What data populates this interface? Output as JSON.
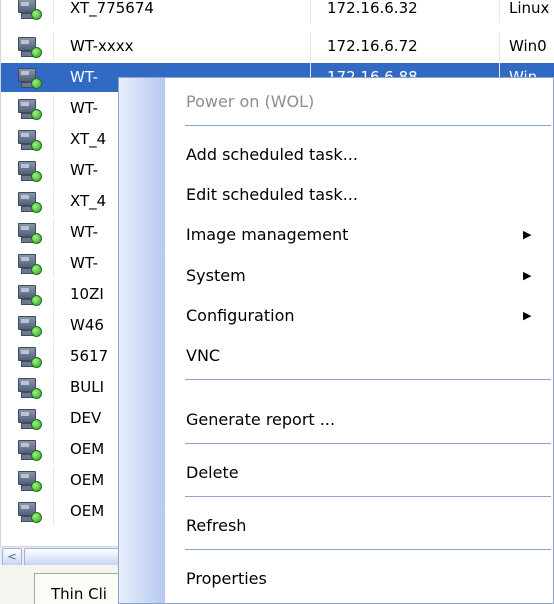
{
  "device_list": {
    "rows": [
      {
        "name": "XT_775674",
        "ip": "172.16.6.32",
        "os": "Linux",
        "selected": false
      },
      {
        "name": "WT-xxxx",
        "ip": "172.16.6.72",
        "os": "Win0",
        "selected": false
      },
      {
        "name": "WT-",
        "ip": "172.16.6.88",
        "os": "Win",
        "selected": true
      },
      {
        "name": "WT-",
        "ip": "",
        "os": "",
        "selected": false
      },
      {
        "name": "XT_4",
        "ip": "",
        "os": "",
        "selected": false
      },
      {
        "name": "WT-",
        "ip": "",
        "os": "",
        "selected": false
      },
      {
        "name": "XT_4",
        "ip": "",
        "os": "",
        "selected": false
      },
      {
        "name": "WT-",
        "ip": "",
        "os": "",
        "selected": false
      },
      {
        "name": "WT-",
        "ip": "",
        "os": "",
        "selected": false
      },
      {
        "name": "10ZI",
        "ip": "",
        "os": "",
        "selected": false
      },
      {
        "name": "W46",
        "ip": "",
        "os": "",
        "selected": false
      },
      {
        "name": "5617",
        "ip": "",
        "os": "",
        "selected": false
      },
      {
        "name": "BULI",
        "ip": "",
        "os": "",
        "selected": false
      },
      {
        "name": "DEV",
        "ip": "",
        "os": "",
        "selected": false
      },
      {
        "name": "OEM",
        "ip": "",
        "os": "",
        "selected": false
      },
      {
        "name": "OEM",
        "ip": "",
        "os": "",
        "selected": false
      },
      {
        "name": "OEM",
        "ip": "",
        "os": "",
        "selected": false
      }
    ]
  },
  "scrollbar": {
    "left_arrow": "<"
  },
  "bottom_tab": {
    "label": "Thin Cli"
  },
  "context_menu": {
    "items": [
      {
        "label": "Power on (WOL)",
        "enabled": false,
        "submenu": false
      },
      {
        "label": "Add scheduled task...",
        "enabled": true,
        "submenu": false
      },
      {
        "label": "Edit scheduled task...",
        "enabled": true,
        "submenu": false
      },
      {
        "label": "Image management",
        "enabled": true,
        "submenu": true
      },
      {
        "label": "System",
        "enabled": true,
        "submenu": true
      },
      {
        "label": "Configuration",
        "enabled": true,
        "submenu": true
      },
      {
        "label": "VNC",
        "enabled": true,
        "submenu": false
      },
      {
        "label": "Generate report ...",
        "enabled": true,
        "submenu": false
      },
      {
        "label": "Delete",
        "enabled": true,
        "submenu": false
      },
      {
        "label": "Refresh",
        "enabled": true,
        "submenu": false
      },
      {
        "label": "Properties",
        "enabled": true,
        "submenu": false
      }
    ],
    "submenu_arrow": "▶"
  },
  "colors": {
    "selection": "#316ac5",
    "disabled_text": "#8d8d8d",
    "separator": "#8fa6cc"
  }
}
